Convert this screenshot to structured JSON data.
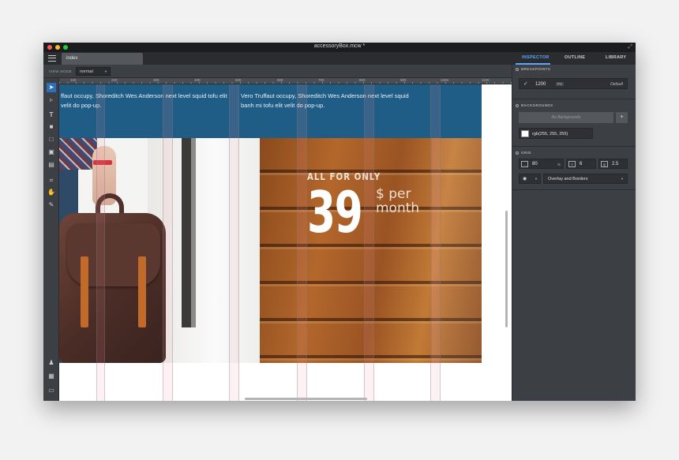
{
  "window": {
    "title": "accessoryBox.mcw *"
  },
  "tabs": [
    {
      "label": "index"
    }
  ],
  "view_mode": {
    "label": "VIEW MODE",
    "value": "normal"
  },
  "ruler": {
    "labels": [
      "100",
      "200",
      "300",
      "400",
      "500",
      "600",
      "700",
      "800",
      "900",
      "1000",
      "1100",
      "1200"
    ]
  },
  "canvas": {
    "banner_text_1": "ffaut occupy, Shoreditch Wes Anderson next level squid tofu elit velit do pop-up.",
    "banner_text_2": "Vero Truffaut occupy, Shoreditch Wes Anderson next level squid banh mi tofu elit velit do pop-up.",
    "offer_small": "ALL FOR ONLY",
    "offer_price": "39",
    "offer_unit_line1": "$ per",
    "offer_unit_line2": "month"
  },
  "inspector": {
    "tabs": [
      "INSPECTOR",
      "OUTLINE",
      "LIBRARY"
    ],
    "active_tab": "INSPECTOR",
    "breakpoints": {
      "heading": "BREAKPOINTS",
      "value": "1200",
      "unit": "PX",
      "default_label": "Default"
    },
    "backgrounds": {
      "heading": "BACKGROUNDS",
      "placeholder": "No Backgrounds",
      "color": "rgb(255, 255, 255)"
    },
    "grid": {
      "heading": "GRID",
      "width_value": "80",
      "width_unit": "%",
      "columns": "6",
      "gutter": "2.5",
      "overlay_mode": "Overlay and Borders"
    }
  },
  "colors": {
    "accent": "#5aa6ff",
    "banner": "#1f5c86",
    "chrome": "#3c3f43"
  }
}
